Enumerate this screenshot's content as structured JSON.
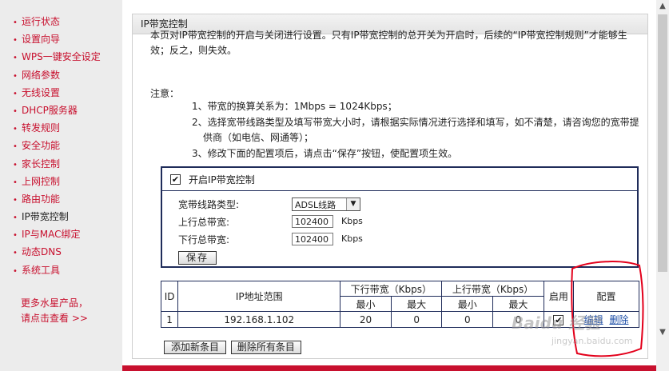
{
  "sidebar": {
    "items": [
      {
        "label": "运行状态"
      },
      {
        "label": "设置向导"
      },
      {
        "label": "WPS一键安全设定"
      },
      {
        "label": "网络参数"
      },
      {
        "label": "无线设置"
      },
      {
        "label": "DHCP服务器"
      },
      {
        "label": "转发规则"
      },
      {
        "label": "安全功能"
      },
      {
        "label": "家长控制"
      },
      {
        "label": "上网控制"
      },
      {
        "label": "路由功能"
      },
      {
        "label": "IP带宽控制"
      },
      {
        "label": "IP与MAC绑定"
      },
      {
        "label": "动态DNS"
      },
      {
        "label": "系统工具"
      }
    ],
    "bullet": "•",
    "more_line1": "更多水星产品，",
    "more_line2": "请点击查看 >>"
  },
  "panel": {
    "title": "IP带宽控制",
    "intro": "本页对IP带宽控制的开启与关闭进行设置。只有IP带宽控制的总开关为开启时，后续的“IP带宽控制规则”才能够生效；反之，则失效。",
    "note_title": "注意：",
    "notes": [
      "1、带宽的换算关系为：1Mbps = 1024Kbps；",
      "2、选择宽带线路类型及填写带宽大小时，请根据实际情况进行选择和填写，如不清楚，请咨询您的宽带提供商（如电信、网通等）；",
      "3、修改下面的配置项后，请点击“保存”按钮，使配置项生效。"
    ]
  },
  "settings": {
    "enable_label": "开启IP带宽控制",
    "enable_checked": "✔",
    "line_type_label": "宽带线路类型:",
    "line_type_value": "ADSL线路",
    "up_label": "上行总带宽:",
    "up_value": "102400",
    "down_label": "下行总带宽:",
    "down_value": "102400",
    "unit": "Kbps",
    "save_label": "保存"
  },
  "rules_table": {
    "headers": {
      "id": "ID",
      "ip_range": "IP地址范围",
      "down": "下行带宽（Kbps）",
      "up": "上行带宽（Kbps）",
      "min": "最小",
      "max": "最大",
      "enable": "启用",
      "config": "配置"
    },
    "rows": [
      {
        "id": "1",
        "ip": "192.168.1.102",
        "down_min": "20",
        "down_max": "0",
        "up_min": "0",
        "up_max": "0",
        "enabled": "✔",
        "edit": "编辑",
        "delete": "删除"
      }
    ]
  },
  "actions": {
    "add_label": "添加新条目",
    "delete_all_label": "删除所有条目"
  },
  "watermark": {
    "text": "Baidu 经验",
    "sub": "jingyan.baidu.com"
  },
  "colors": {
    "brand_red": "#c8102e",
    "border_navy": "#1f2c5a",
    "link_blue": "#1f4fa8"
  }
}
